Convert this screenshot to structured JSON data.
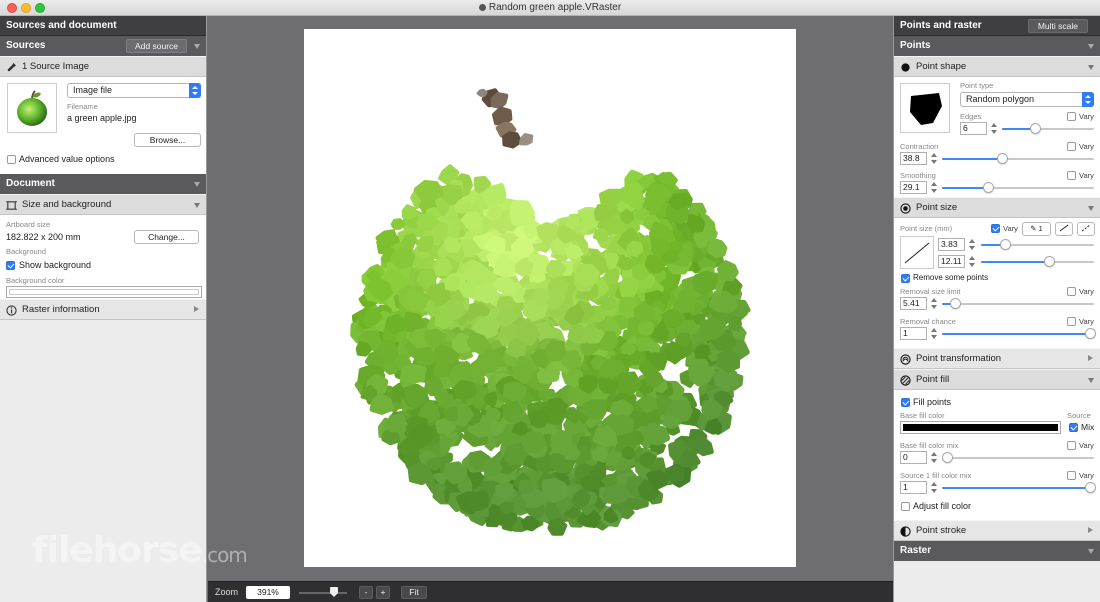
{
  "window": {
    "title": "Random green apple.VRaster"
  },
  "left_panel": {
    "header": "Sources and document",
    "sources": {
      "title": "Sources",
      "add_button": "Add source"
    },
    "source_image": {
      "title": "1 Source Image",
      "type_select": "Image file",
      "filename_label": "Filename",
      "filename": "a green apple.jpg",
      "browse_button": "Browse...",
      "advanced_option": "Advanced value options"
    },
    "document": {
      "title": "Document"
    },
    "size_background": {
      "title": "Size and background",
      "artboard_label": "Artboard size",
      "artboard_value": "182.822 x 200 mm",
      "change_button": "Change...",
      "background_label": "Background",
      "show_background": "Show background",
      "bg_color_label": "Background color"
    },
    "raster_info": {
      "title": "Raster information"
    }
  },
  "right_panel": {
    "header": "Points and raster",
    "multi_scale_button": "Multi scale",
    "points": {
      "title": "Points"
    },
    "point_shape": {
      "title": "Point shape",
      "type_label": "Point type",
      "type_value": "Random polygon",
      "edges_label": "Edges",
      "edges_value": "6",
      "contraction_label": "Contraction",
      "contraction_value": "38.8",
      "smoothing_label": "Smoothing",
      "smoothing_value": "29.1",
      "vary": "Vary"
    },
    "point_size": {
      "title": "Point size",
      "size_label": "Point size (mm)",
      "vary": "Vary",
      "count_badge": "1",
      "min_value": "3.83",
      "max_value": "12.11",
      "remove_points": "Remove some points",
      "removal_limit_label": "Removal size limit",
      "removal_limit_value": "5.41",
      "removal_chance_label": "Removal chance",
      "removal_chance_value": "1"
    },
    "point_transformation": {
      "title": "Point transformation"
    },
    "point_fill": {
      "title": "Point fill",
      "fill_points": "Fill points",
      "source_label": "Source",
      "base_fill_label": "Base fill color",
      "mix_label": "Mix",
      "base_mix_label": "Base fill color mix",
      "base_mix_value": "0",
      "source_mix_label": "Source 1 fill color mix",
      "source_mix_value": "1",
      "adjust_fill": "Adjust fill color",
      "vary": "Vary"
    },
    "point_stroke": {
      "title": "Point stroke"
    },
    "raster": {
      "title": "Raster"
    }
  },
  "zoom": {
    "label": "Zoom",
    "value": "391%",
    "minus": "-",
    "plus": "+",
    "fit": "Fit",
    "slider_fraction": 0.72
  },
  "watermark": {
    "main": "filehorse",
    "suffix": ".com"
  },
  "colors": {
    "accent": "#2f7cf6",
    "panel_dark": "#3f3f42",
    "apple_green": "#7cc43a"
  }
}
